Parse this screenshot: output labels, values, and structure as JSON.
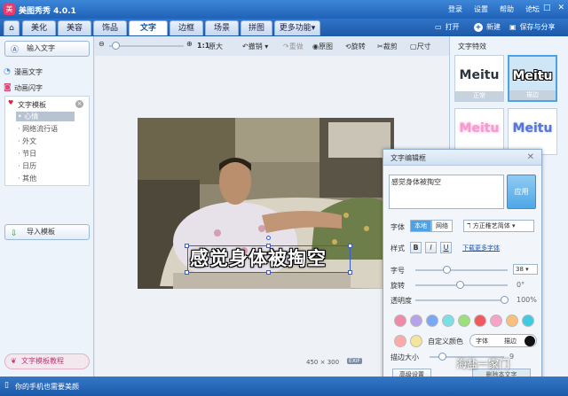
{
  "app": {
    "title": "美图秀秀 4.0.1",
    "logo_glyph": "美"
  },
  "titlebar": {
    "links": [
      "登录",
      "设置",
      "帮助",
      "论坛"
    ]
  },
  "tabs": [
    "美化",
    "美容",
    "饰品",
    "文字",
    "边框",
    "场景",
    "拼图",
    "更多功能"
  ],
  "active_tab": "文字",
  "top_actions": {
    "open": "打开",
    "new": "新建",
    "save": "保存与分享"
  },
  "sidebar": {
    "input_text": "输入文字",
    "comic_text": "漫画文字",
    "animated_text": "动画闪字",
    "template_root": "文字模板",
    "template_items": [
      "心情",
      "网络流行语",
      "外文",
      "节日",
      "日历",
      "其他"
    ],
    "import_template": "导入模板",
    "tutorial": "文字模板教程"
  },
  "toolbar": {
    "ratio": "1:1",
    "original": "原大",
    "undo": "撤销",
    "redo": "重做",
    "source": "原图",
    "rotate": "旋转",
    "crop": "裁剪",
    "resize": "尺寸"
  },
  "canvas": {
    "overlay_text": "感觉身体被掏空",
    "width": "450",
    "height": "300",
    "exif": "EXIF"
  },
  "effects": {
    "title": "文字特效",
    "items": [
      {
        "word": "Meitu",
        "label": "正常",
        "color": "#2c3440",
        "selected": false
      },
      {
        "word": "Meitu",
        "label": "描边",
        "color": "#ffffff",
        "selected": true
      },
      {
        "word": "Meitu",
        "label": "",
        "color": "#f49ad3",
        "selected": false
      },
      {
        "word": "Meitu",
        "label": "",
        "color": "#5b73e0",
        "selected": false
      }
    ]
  },
  "dialog": {
    "title": "文字编辑框",
    "text_value": "感觉身体被掏空",
    "apply": "应用",
    "font_label": "字体",
    "local": "本地",
    "network": "网络",
    "font_name": "方正稚艺简体",
    "style_label": "样式",
    "bold": "B",
    "italic": "I",
    "underline": "U",
    "download_link": "下载更多字体",
    "size_label": "字号",
    "size_value": "38",
    "size_fraction": 0.35,
    "rotate_label": "旋转",
    "rotate_value": "0°",
    "rotate_fraction": 0.5,
    "opacity_label": "透明度",
    "opacity_value": "100%",
    "opacity_fraction": 1.0,
    "custom_color": "自定义颜色",
    "mode_font": "字体",
    "mode_stroke": "描边",
    "stroke_size_label": "描边大小",
    "stroke_size_value": "9",
    "advanced": "高级设置",
    "delete": "删除本文字",
    "swatch_colors_row1": [
      "#f08aa9",
      "#b6a3e8",
      "#7ba8f2",
      "#7bdfe4",
      "#9be07a",
      "#f2595d",
      "#f5a3c7",
      "#f8c07c",
      "#41c9e0"
    ],
    "swatch_colors_row2": [
      "#ffaaaa",
      "#f4e79b"
    ]
  },
  "watermark": "海盐一家门",
  "status": {
    "text": "你的手机也需要美颜"
  }
}
